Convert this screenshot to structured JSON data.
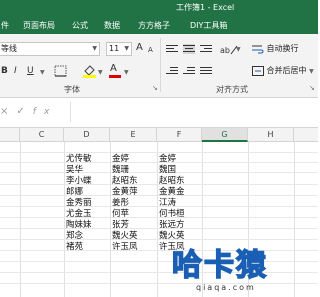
{
  "titlebar": {
    "title": "工作簿1 - Excel"
  },
  "menu": {
    "items": [
      "件",
      "页面布局",
      "公式",
      "数据",
      "方方格子",
      "DIY工具箱"
    ]
  },
  "ribbon": {
    "font_name": "等线",
    "font_size": "11",
    "grow_font": "A",
    "shrink_font": "A",
    "bold": "B",
    "italic": "I",
    "underline": "U",
    "font_color_letter": "A",
    "font_group_label": "字体",
    "wrap_text_label": "自动换行",
    "merge_center_label": "合并后居中",
    "alignment_group_label": "对齐方式"
  },
  "formula_bar": {
    "icons": [
      "×",
      "✓",
      "fx"
    ],
    "content": ""
  },
  "columns": [
    "C",
    "D",
    "E",
    "F",
    "G",
    "H"
  ],
  "active_column": "G",
  "cells": {
    "D": [
      "尤传敏",
      "吴华",
      "李小蝶",
      "郎娜",
      "金秀丽",
      "尤金玉",
      "陶妹妹",
      "郑念",
      "褚苑"
    ],
    "E": [
      "金婷",
      "魏珊",
      "赵昭东",
      "金黄萍",
      "姜彤",
      "何苹",
      "张芳",
      "魏火英",
      "许玉凤"
    ],
    "F": [
      "金婷",
      "魏国",
      "赵昭东",
      "金黄金",
      "江涛",
      "何书桓",
      "张远方",
      "魏火英",
      "许玉凤"
    ]
  },
  "watermark": {
    "text": "哈卡猿",
    "url": "qiaqa.com"
  },
  "colors": {
    "excel_green": "#217346",
    "ribbon_bg": "#f3f3f3",
    "watermark_blue": "#1a5fb4"
  }
}
